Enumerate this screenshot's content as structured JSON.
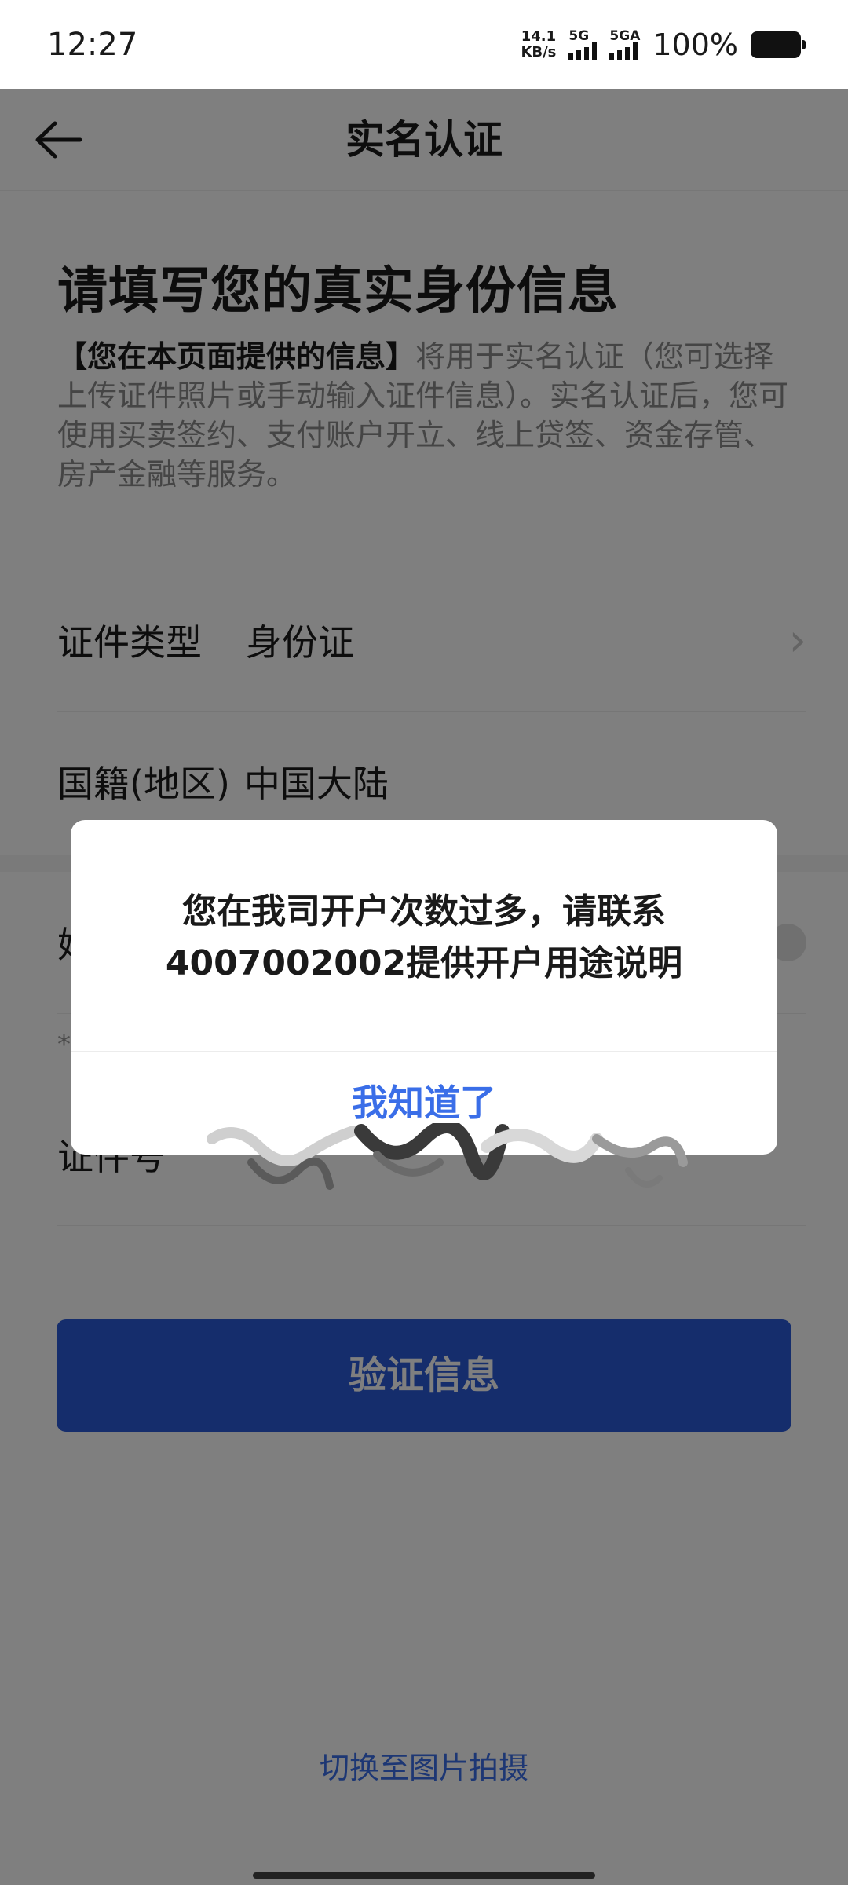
{
  "status": {
    "time": "12:27",
    "net_speed_value": "14.1",
    "net_speed_unit": "KB/s",
    "sim1": "5G",
    "sim2": "5GA",
    "battery": "100%"
  },
  "nav": {
    "title": "实名认证"
  },
  "main": {
    "headline": "请填写您的真实身份信息",
    "intro_bold": "【您在本页面提供的信息】",
    "intro_rest": "将用于实名认证（您可选择上传证件照片或手动输入证件信息）。实名认证后，您可使用买卖签约、支付账户开立、线上贷签、资金存管、房产金融等服务。"
  },
  "form": {
    "id_type_label": "证件类型",
    "id_type_value": "身份证",
    "nationality_label": "国籍(地区)",
    "nationality_value": "中国大陆",
    "name_label": "姓名",
    "note": "*",
    "id_number_label": "证件号"
  },
  "actions": {
    "verify_button": "验证信息",
    "switch_link": "切换至图片拍摄"
  },
  "dialog": {
    "message": "您在我司开户次数过多，请联系4007002002提供开户用途说明",
    "confirm_button": "我知道了"
  }
}
